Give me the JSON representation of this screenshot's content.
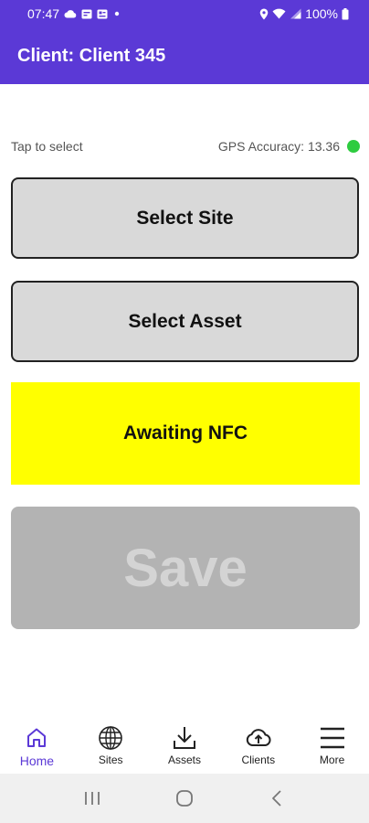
{
  "status_bar": {
    "time": "07:47",
    "battery": "100%",
    "left_icons": [
      "cloud-icon",
      "message-icon",
      "gallery-icon",
      "dot-icon"
    ],
    "right_icons": [
      "location-icon",
      "wifi-icon",
      "signal-icon",
      "battery-icon"
    ]
  },
  "app_bar": {
    "title": "Client: Client 345"
  },
  "info": {
    "hint": "Tap to select",
    "gps_label": "GPS Accuracy: 13.36",
    "gps_status_color": "#2ecc40"
  },
  "buttons": {
    "select_site": "Select Site",
    "select_asset": "Select Asset",
    "nfc_status": "Awaiting NFC",
    "save": "Save"
  },
  "colors": {
    "primary": "#5b39d6",
    "nfc_background": "#ffff00",
    "save_disabled": "#b3b3b3"
  },
  "bottom_nav": {
    "items": [
      {
        "label": "Home",
        "icon": "home-icon",
        "active": true
      },
      {
        "label": "Sites",
        "icon": "globe-icon",
        "active": false
      },
      {
        "label": "Assets",
        "icon": "download-icon",
        "active": false
      },
      {
        "label": "Clients",
        "icon": "cloud-upload-icon",
        "active": false
      },
      {
        "label": "More",
        "icon": "menu-icon",
        "active": false
      }
    ]
  },
  "system_nav": {
    "buttons": [
      "recents-icon",
      "home-circle-icon",
      "back-icon"
    ]
  }
}
